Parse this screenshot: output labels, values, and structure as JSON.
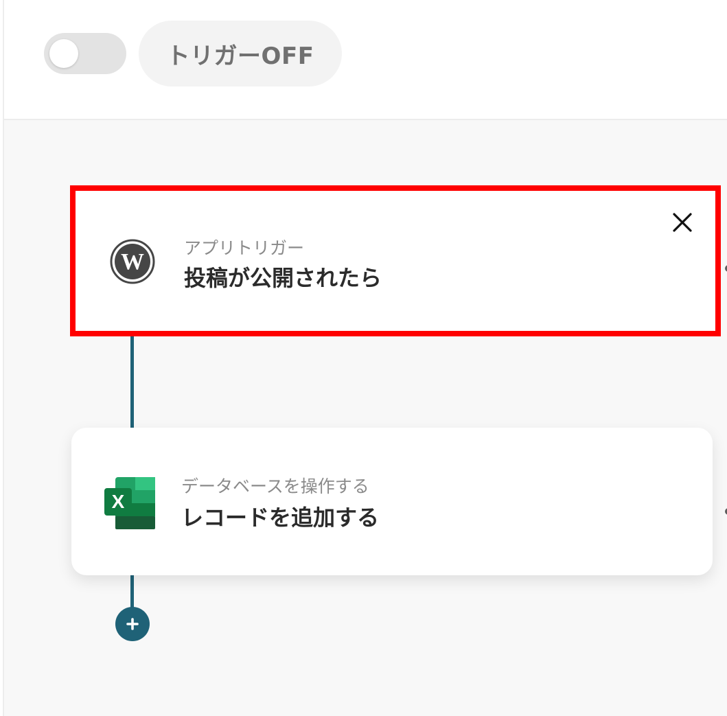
{
  "header": {
    "trigger_status_label": "トリガーOFF",
    "toggle_state": "off"
  },
  "flow": {
    "steps": [
      {
        "icon": "wordpress-icon",
        "subtitle": "アプリトリガー",
        "title": "投稿が公開されたら",
        "highlighted": true,
        "highlight_color": "#ff0000"
      },
      {
        "icon": "excel-icon",
        "subtitle": "データベースを操作する",
        "title": "レコードを追加する",
        "highlighted": false
      }
    ],
    "connector_color": "#1f6277",
    "add_step_icon": "plus-icon"
  }
}
